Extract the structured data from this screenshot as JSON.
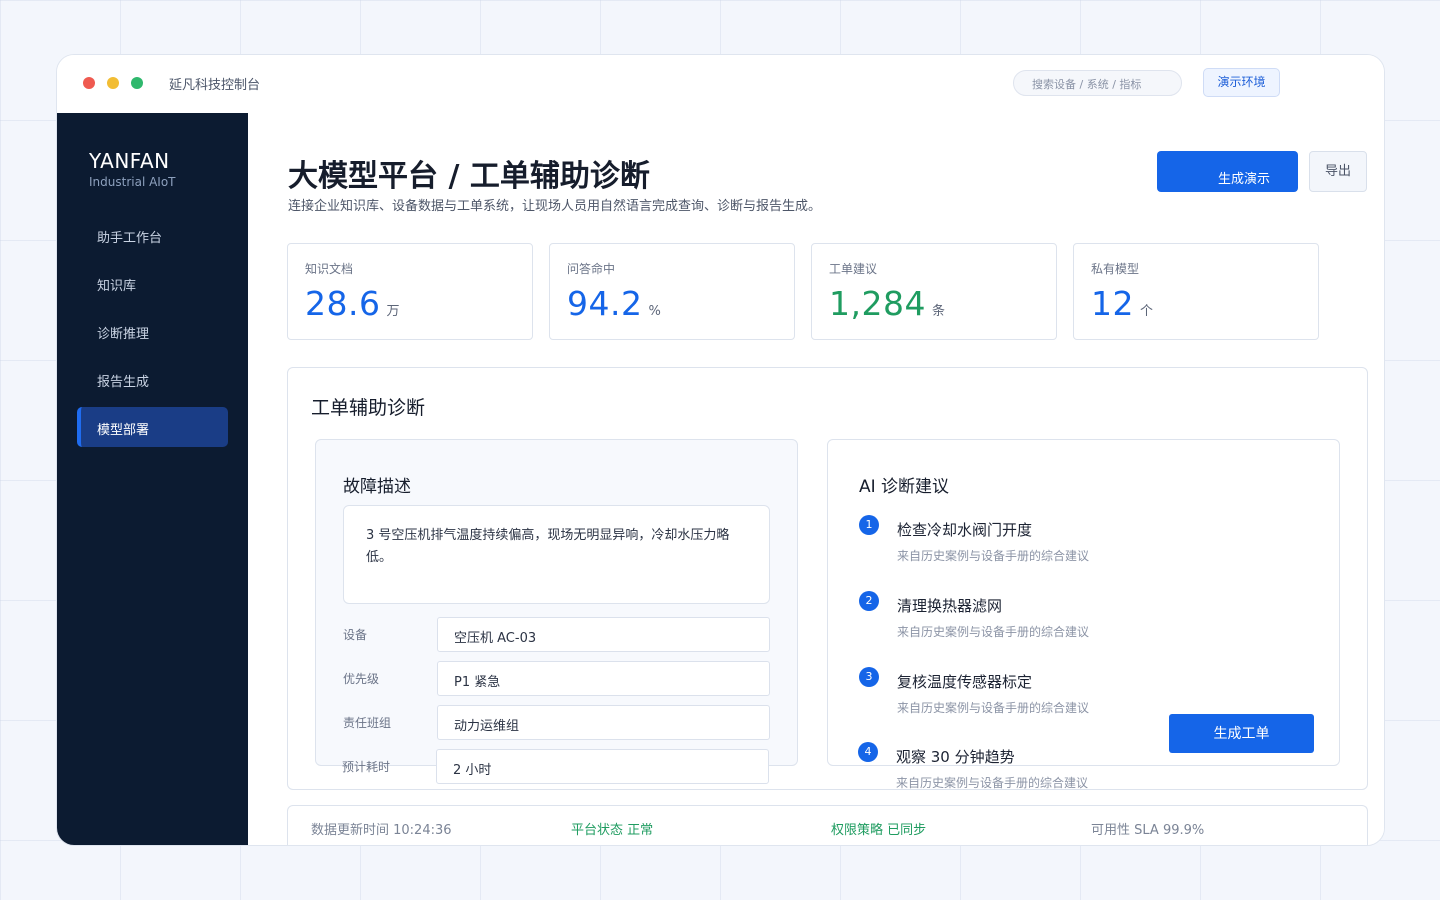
{
  "window": {
    "app_title": "延凡科技控制台",
    "search_placeholder": "搜索设备 / 系统 / 指标",
    "env_badge": "演示环境"
  },
  "sidebar": {
    "brand": "YANFAN",
    "brand_sub": "Industrial AIoT",
    "items": [
      {
        "label": "助手工作台",
        "active": false
      },
      {
        "label": "知识库",
        "active": false
      },
      {
        "label": "诊断推理",
        "active": false
      },
      {
        "label": "报告生成",
        "active": false
      },
      {
        "label": "模型部署",
        "active": true
      }
    ]
  },
  "header": {
    "title": "大模型平台 / 工单辅助诊断",
    "description": "连接企业知识库、设备数据与工单系统，让现场人员用自然语言完成查询、诊断与报告生成。",
    "primary_button": "生成演示",
    "secondary_button": "导出"
  },
  "stats": [
    {
      "label": "知识文档",
      "value": "28.6",
      "unit": "万",
      "color": "#1565e8"
    },
    {
      "label": "问答命中",
      "value": "94.2",
      "unit": "%",
      "color": "#1565e8"
    },
    {
      "label": "工单建议",
      "value": "1,284",
      "unit": "条",
      "color": "#1f9c60"
    },
    {
      "label": "私有模型",
      "value": "12",
      "unit": "个",
      "color": "#1565e8"
    }
  ],
  "panel": {
    "title": "工单辅助诊断",
    "fault": {
      "title": "故障描述",
      "description": "3 号空压机排气温度持续偏高，现场无明显异响，冷却水压力略低。",
      "fields": [
        {
          "label": "设备",
          "value": "空压机 AC-03"
        },
        {
          "label": "优先级",
          "value": "P1 紧急"
        },
        {
          "label": "责任班组",
          "value": "动力运维组"
        },
        {
          "label": "预计耗时",
          "value": "2 小时"
        }
      ]
    },
    "ai": {
      "title": "AI 诊断建议",
      "suggestions": [
        {
          "num": "1",
          "title": "检查冷却水阀门开度",
          "sub": "来自历史案例与设备手册的综合建议"
        },
        {
          "num": "2",
          "title": "清理换热器滤网",
          "sub": "来自历史案例与设备手册的综合建议"
        },
        {
          "num": "3",
          "title": "复核温度传感器标定",
          "sub": "来自历史案例与设备手册的综合建议"
        },
        {
          "num": "4",
          "title": "观察 30 分钟趋势",
          "sub": "来自历史案例与设备手册的综合建议"
        }
      ],
      "button": "生成工单"
    }
  },
  "statusbar": {
    "updated": "数据更新时间 10:24:36",
    "platform": "平台状态 正常",
    "policy": "权限策略 已同步",
    "sla": "可用性 SLA 99.9%"
  }
}
